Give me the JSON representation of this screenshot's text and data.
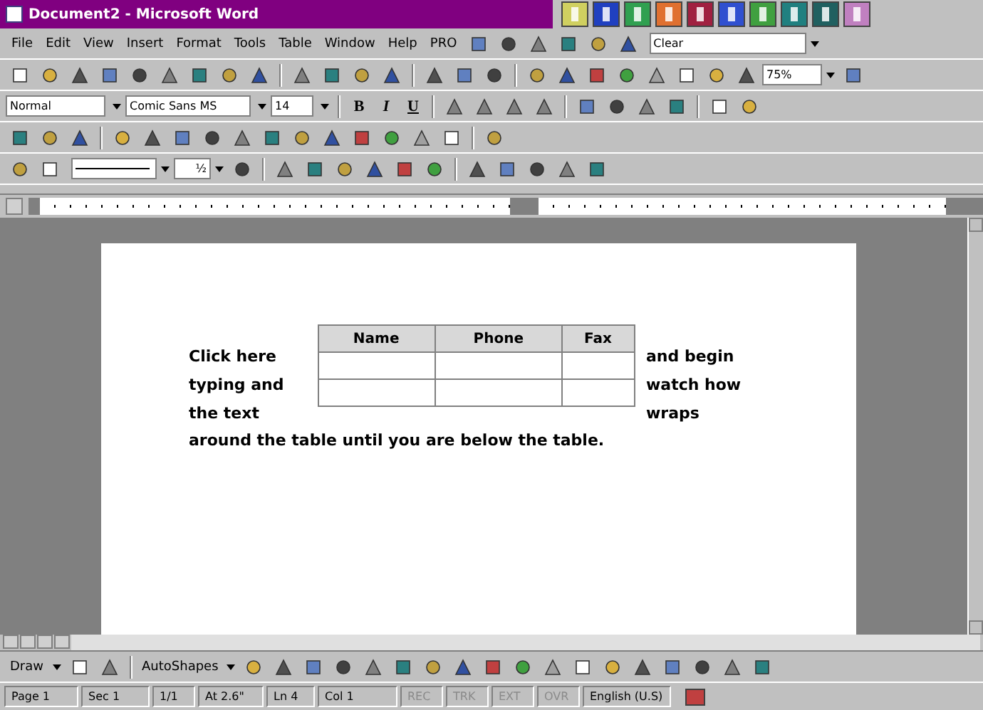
{
  "window": {
    "title": "Document2 - Microsoft Word"
  },
  "menu": {
    "items": [
      "File",
      "Edit",
      "View",
      "Insert",
      "Format",
      "Tools",
      "Table",
      "Window",
      "Help",
      "PRO"
    ],
    "field": "Clear"
  },
  "standard_toolbar": {
    "zoom": "75%"
  },
  "formatting_toolbar": {
    "style": "Normal",
    "font": "Comic Sans MS",
    "size": "14",
    "buttons": [
      "B",
      "I",
      "U"
    ]
  },
  "tables_toolbar": {
    "line_weight": "½"
  },
  "document": {
    "left_text": [
      "Click here",
      "typing and",
      "the text"
    ],
    "right_text": [
      "and begin",
      "watch how",
      "wraps"
    ],
    "table": {
      "columns": [
        "Name",
        "Phone",
        "Fax"
      ]
    },
    "after_text": "around the table until you are below the table."
  },
  "drawing_toolbar": {
    "draw": "Draw",
    "autoshapes": "AutoShapes"
  },
  "status_bar": [
    {
      "text": "Page 1",
      "disabled": false
    },
    {
      "text": "Sec 1",
      "disabled": false
    },
    {
      "text": "1/1",
      "disabled": false
    },
    {
      "text": "At 2.6\"",
      "disabled": false
    },
    {
      "text": "Ln 4",
      "disabled": false
    },
    {
      "text": "Col 1",
      "disabled": false
    },
    {
      "text": "REC",
      "disabled": true
    },
    {
      "text": "TRK",
      "disabled": true
    },
    {
      "text": "EXT",
      "disabled": true
    },
    {
      "text": "OVR",
      "disabled": true
    },
    {
      "text": "English (U.S)",
      "disabled": false
    }
  ]
}
